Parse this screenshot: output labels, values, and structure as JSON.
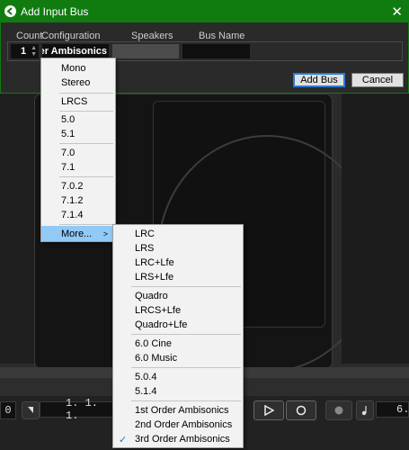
{
  "dialog": {
    "title": "Add Input Bus",
    "headers": {
      "count": "Count",
      "configuration": "Configuration",
      "speakers": "Speakers",
      "bus_name": "Bus Name"
    },
    "count_value": "1",
    "configuration_value": "3rd Order Ambisonics",
    "add_bus_label": "Add Bus",
    "cancel_label": "Cancel"
  },
  "menu1": {
    "items": [
      "Mono",
      "Stereo",
      "LRCS",
      "5.0",
      "5.1",
      "7.0",
      "7.1",
      "7.0.2",
      "7.1.2",
      "7.1.4",
      "More..."
    ]
  },
  "menu2": {
    "items": [
      "LRC",
      "LRS",
      "LRC+Lfe",
      "LRS+Lfe",
      "Quadro",
      "LRCS+Lfe",
      "Quadro+Lfe",
      "6.0 Cine",
      "6.0 Music",
      "5.0.4",
      "5.1.4",
      "1st Order Ambisonics",
      "2nd Order Ambisonics",
      "3rd Order Ambisonics"
    ],
    "selected": "3rd Order Ambisonics"
  },
  "transport": {
    "left_value": "0",
    "position": "1. 1. 1.",
    "right_value": "6."
  },
  "colors": {
    "titlebar": "#107c10",
    "highlight": "#91c9f7",
    "check": "#1a73c9"
  }
}
